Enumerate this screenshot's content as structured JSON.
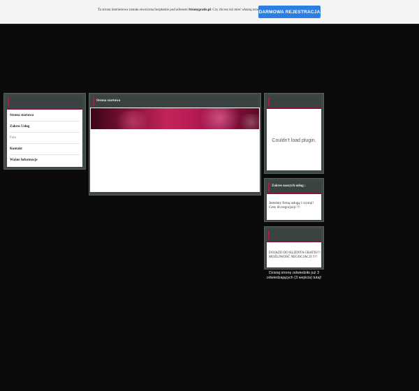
{
  "topbar": {
    "notice_prefix": "Ta strona internetowa została stworzona bezpłatnie pod adresem ",
    "notice_site": "Stronygratis.pl",
    "notice_suffix": ". Czy chcesz też mieć własną stronę?",
    "register_button": "DARMOWA REJESTRACJA"
  },
  "colors": {
    "accent_button": "#2d7ee3",
    "accent_mark": "#b0194e",
    "panel_bg": "#3f4747",
    "page_bg": "#0a0a0a"
  },
  "nav": {
    "items": [
      {
        "label": "Strona startowa",
        "style": "bold"
      },
      {
        "label": "Zakres Usług",
        "style": "bold"
      },
      {
        "label": "Foto",
        "style": "light"
      },
      {
        "label": "Kontakt",
        "style": "bold"
      },
      {
        "label": "Ważne Informacje",
        "style": "bold"
      }
    ]
  },
  "main": {
    "title": "Strona startowa"
  },
  "plugin": {
    "message": "Couldn't load plugin."
  },
  "services": {
    "title": "Zakres naszych usług :",
    "text": "Jesteśmy firmą usługą i czystą!! Ceny do negocjacji !!!"
  },
  "promo": {
    "text": "DOJAZD DO KLIENTA GRATIS!!! MOŻLIWOŚĆ NEGOCJACJI !!!!"
  },
  "counter": {
    "text": "Dzisiaj stronę odwiedziło już 3 odwiedzających (3 wejścia) tutaj!"
  }
}
